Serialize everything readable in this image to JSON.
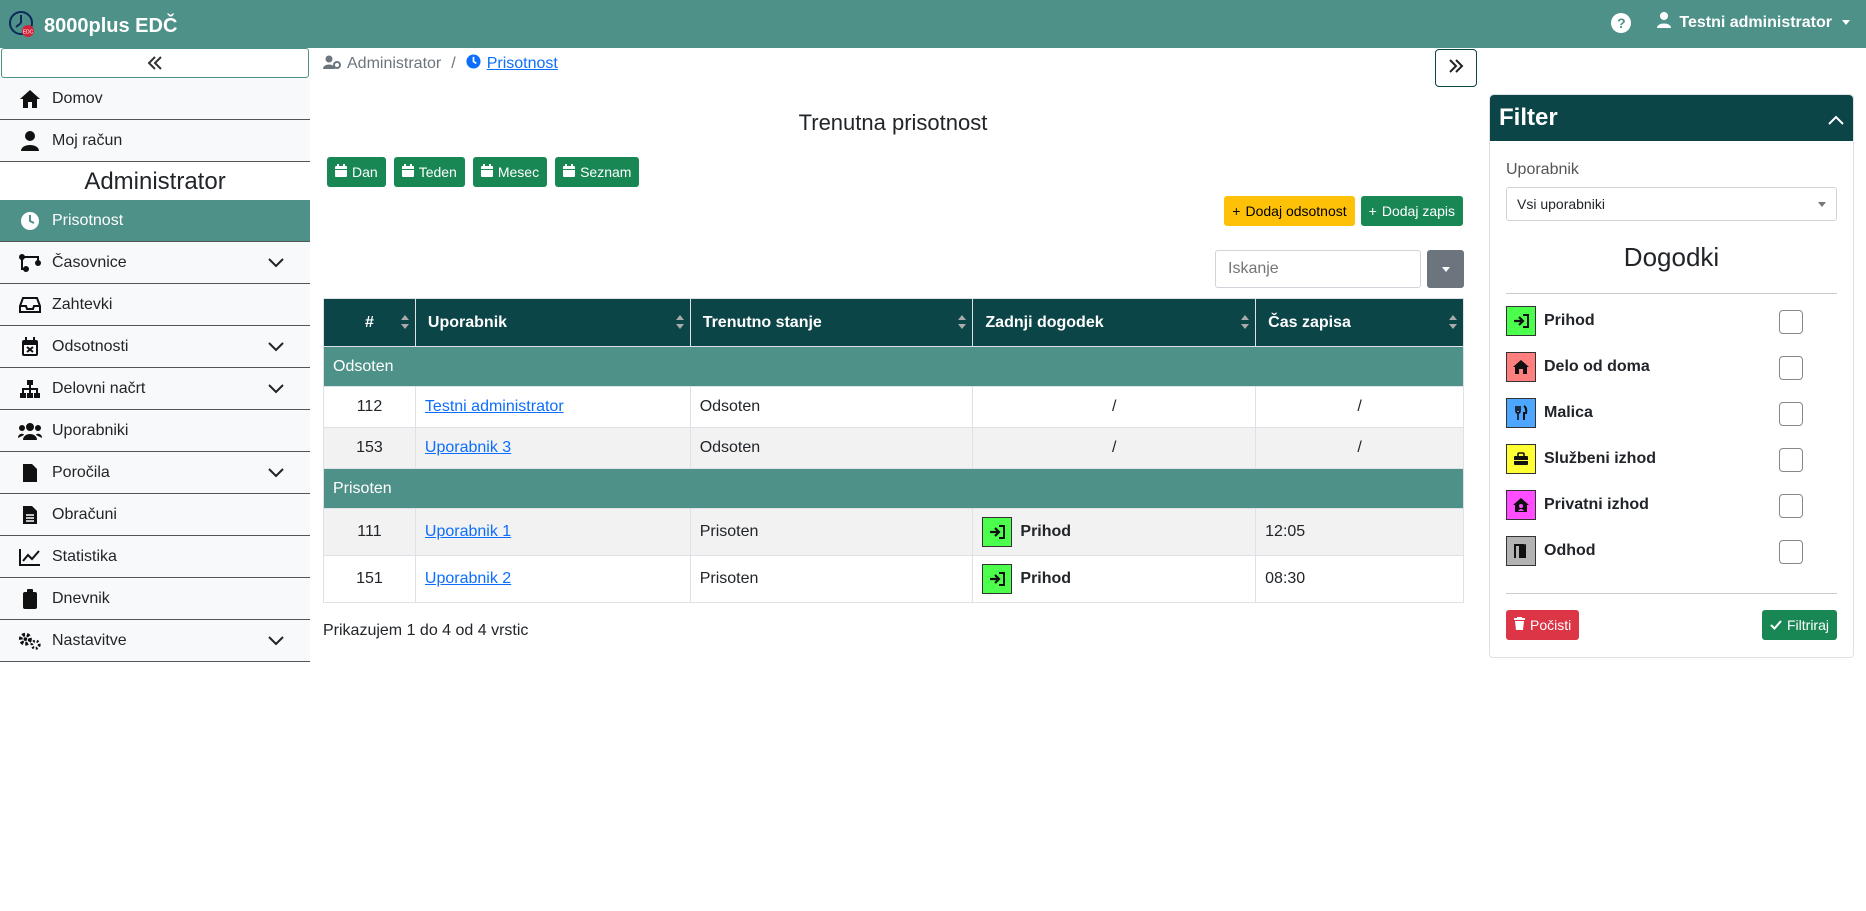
{
  "app": {
    "title": "8000plus EDČ",
    "logo_text": "EDC"
  },
  "topbar": {
    "help_label": "?",
    "user_name": "Testni administrator"
  },
  "sidebar": {
    "items_top": [
      {
        "label": "Domov",
        "icon": "home-icon"
      },
      {
        "label": "Moj račun",
        "icon": "user-icon"
      }
    ],
    "section_title": "Administrator",
    "items": [
      {
        "label": "Prisotnost",
        "icon": "clock-icon",
        "active": true
      },
      {
        "label": "Časovnice",
        "icon": "schedule-icon",
        "expandable": true
      },
      {
        "label": "Zahtevki",
        "icon": "inbox-icon"
      },
      {
        "label": "Odsotnosti",
        "icon": "calendar-x-icon",
        "expandable": true
      },
      {
        "label": "Delovni načrt",
        "icon": "sitemap-icon",
        "expandable": true
      },
      {
        "label": "Uporabniki",
        "icon": "users-icon"
      },
      {
        "label": "Poročila",
        "icon": "file-icon",
        "expandable": true
      },
      {
        "label": "Obračuni",
        "icon": "file-lines-icon"
      },
      {
        "label": "Statistika",
        "icon": "chart-line-icon"
      },
      {
        "label": "Dnevnik",
        "icon": "clipboard-icon"
      },
      {
        "label": "Nastavitve",
        "icon": "gears-icon",
        "expandable": true
      }
    ]
  },
  "breadcrumb": {
    "parent": "Administrator",
    "separator": "/",
    "current": "Prisotnost"
  },
  "main": {
    "title": "Trenutna prisotnost",
    "view_buttons": [
      "Dan",
      "Teden",
      "Mesec",
      "Seznam"
    ],
    "add_absence": "Dodaj odsotnost",
    "add_entry": "Dodaj zapis",
    "search_placeholder": "Iskanje"
  },
  "table": {
    "headers": [
      "#",
      "Uporabnik",
      "Trenutno stanje",
      "Zadnji dogodek",
      "Čas zapisa"
    ],
    "groups": [
      {
        "name": "Odsoten",
        "rows": [
          {
            "id": "112",
            "user": "Testni administrator",
            "state": "Odsoten",
            "event": "/",
            "time": "/"
          },
          {
            "id": "153",
            "user": "Uporabnik 3",
            "state": "Odsoten",
            "event": "/",
            "time": "/"
          }
        ]
      },
      {
        "name": "Prisoten",
        "rows": [
          {
            "id": "111",
            "user": "Uporabnik 1",
            "state": "Prisoten",
            "event": "Prihod",
            "time": "12:05"
          },
          {
            "id": "151",
            "user": "Uporabnik 2",
            "state": "Prisoten",
            "event": "Prihod",
            "time": "08:30"
          }
        ]
      }
    ],
    "footer": "Prikazujem 1 do 4 od 4 vrstic"
  },
  "filter": {
    "title": "Filter",
    "user_label": "Uporabnik",
    "user_value": "Vsi uporabniki",
    "events_title": "Dogodki",
    "events": [
      {
        "label": "Prihod",
        "color": "#4cff4c",
        "icon": "sign-in-icon"
      },
      {
        "label": "Delo od doma",
        "color": "#ff7f7f",
        "icon": "house-icon"
      },
      {
        "label": "Malica",
        "color": "#4da6ff",
        "icon": "utensils-icon"
      },
      {
        "label": "Službeni izhod",
        "color": "#ffff33",
        "icon": "briefcase-icon"
      },
      {
        "label": "Privatni izhod",
        "color": "#ff4dff",
        "icon": "house-user-icon"
      },
      {
        "label": "Odhod",
        "color": "#b3b3b3",
        "icon": "door-open-icon"
      }
    ],
    "clear_label": "Počisti",
    "apply_label": "Filtriraj"
  },
  "colors": {
    "topbar": "#4e9188",
    "table_header": "#0b4548",
    "group_row": "#4e9188",
    "success": "#198754",
    "warning": "#ffc107",
    "danger": "#dc3545"
  }
}
